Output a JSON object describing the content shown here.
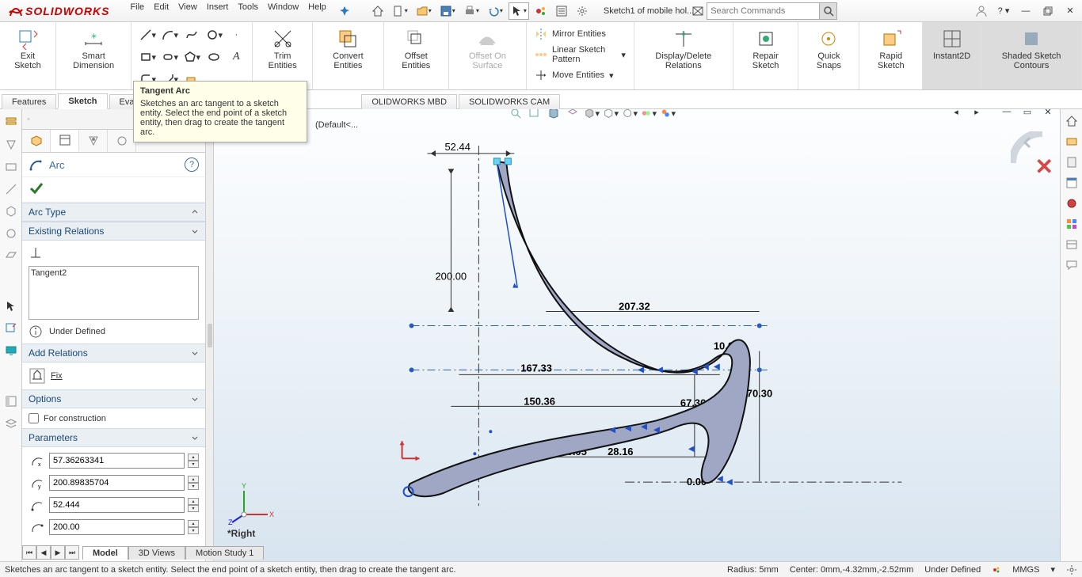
{
  "titlebar": {
    "logo_text": "SOLIDWORKS",
    "menu": [
      "File",
      "Edit",
      "View",
      "Insert",
      "Tools",
      "Window",
      "Help"
    ],
    "doc_name": "Sketch1 of mobile hol...",
    "search_placeholder": "Search Commands"
  },
  "ribbon": {
    "exit_sketch": "Exit Sketch",
    "smart_dimension": "Smart Dimension",
    "trim_entities": "Trim Entities",
    "convert_entities": "Convert Entities",
    "offset_entities": "Offset Entities",
    "offset_on_surface": "Offset On Surface",
    "mirror_entities": "Mirror Entities",
    "linear_sketch_pattern": "Linear Sketch Pattern",
    "move_entities": "Move Entities",
    "display_delete_relations": "Display/Delete Relations",
    "repair_sketch": "Repair Sketch",
    "quick_snaps": "Quick Snaps",
    "rapid_sketch": "Rapid Sketch",
    "instant2d": "Instant2D",
    "shaded_sketch_contours": "Shaded Sketch Contours"
  },
  "cmd_tabs": [
    "Features",
    "Sketch",
    "Evaluate",
    "",
    "OLIDWORKS MBD",
    "SOLIDWORKS CAM"
  ],
  "panel": {
    "title": "Arc",
    "sec_arc_type": "Arc Type",
    "sec_existing_relations": "Existing Relations",
    "relation_items": [
      "Tangent2"
    ],
    "status": "Under Defined",
    "sec_add_relations": "Add Relations",
    "add_fix": "Fix",
    "sec_options": "Options",
    "for_construction": "For construction",
    "sec_parameters": "Parameters",
    "params": [
      "57.36263341",
      "200.89835704",
      "52.444",
      "200.00"
    ]
  },
  "viewport": {
    "default_label": "(Default<...",
    "view_name": "*Right",
    "dims": {
      "d_5244": "52.44",
      "d_20000": "200.00",
      "d_20732": "207.32",
      "d_16733": "167.33",
      "d_15036": "150.36",
      "d_20005": "200.05",
      "d_2816": "28.16",
      "d_6730": "67.30",
      "d_7030": "70.30",
      "d_1000": "10.00",
      "d_000": "0.00"
    }
  },
  "bottom_tabs": [
    "Model",
    "3D Views",
    "Motion Study 1"
  ],
  "statusbar": {
    "hint": "Sketches an arc tangent to a sketch entity. Select the end point of a sketch entity, then drag to create the tangent arc.",
    "radius": "Radius: 5mm",
    "center": "Center: 0mm,-4.32mm,-2.52mm",
    "defined": "Under Defined",
    "units": "MMGS"
  },
  "tooltip": {
    "title": "Tangent Arc",
    "body": "Sketches an arc tangent to a sketch entity. Select the end point of a sketch entity, then drag to create the tangent arc."
  }
}
